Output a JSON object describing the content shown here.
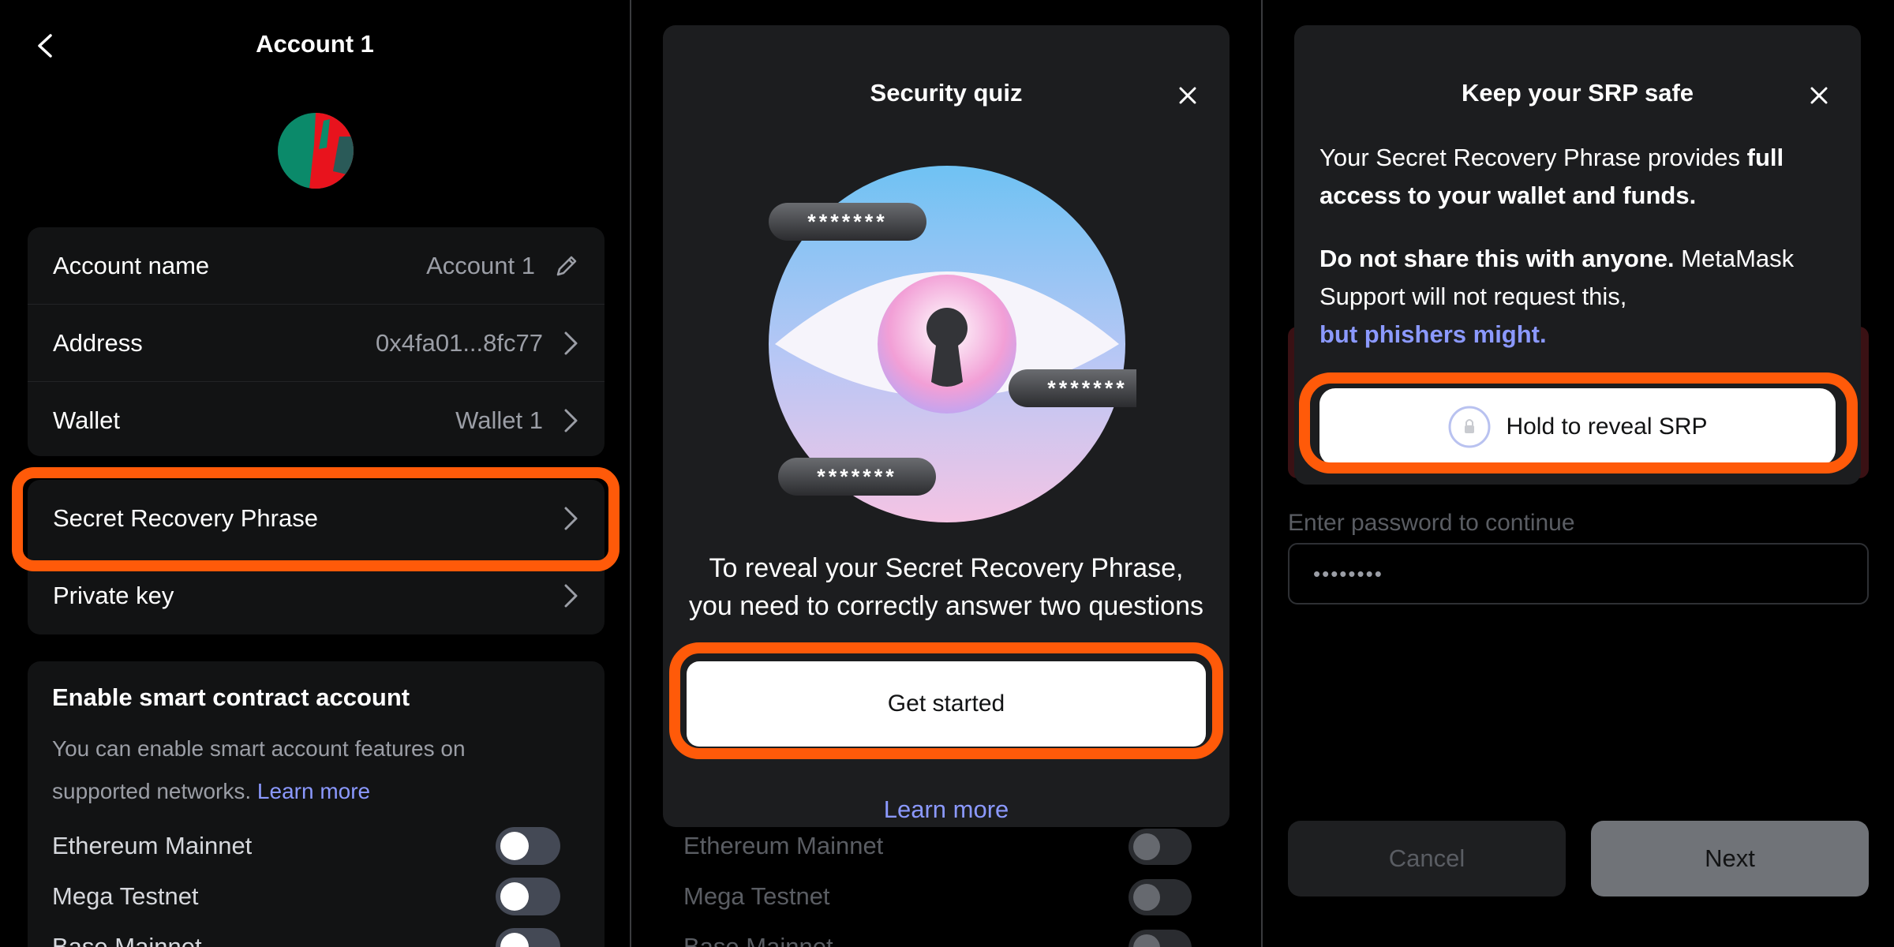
{
  "panel_account": {
    "title": "Account 1",
    "rows": [
      {
        "label": "Account name",
        "value": "Account 1"
      },
      {
        "label": "Address",
        "value": "0x4fa01...8fc77"
      },
      {
        "label": "Wallet",
        "value": "Wallet 1"
      }
    ],
    "srp_label": "Secret Recovery Phrase",
    "private_key_label": "Private key",
    "smart_account": {
      "title": "Enable smart contract account",
      "description": "You can enable smart account features on supported networks.",
      "learn_more": "Learn more"
    },
    "networks": [
      "Ethereum Mainnet",
      "Mega Testnet",
      "Base Mainnet"
    ]
  },
  "panel_quiz": {
    "title": "Security quiz",
    "password_mask": "*******",
    "description": "To reveal your Secret Recovery Phrase, you need to correctly answer two questions",
    "primary_button": "Get started",
    "learn_more": "Learn more",
    "background_networks": [
      "Ethereum Mainnet",
      "Mega Testnet",
      "Base Mainnet"
    ]
  },
  "panel_srp": {
    "modal_title": "Keep your SRP safe",
    "para1_normal": "Your Secret Recovery Phrase provides ",
    "para1_bold": "full access to your wallet and funds.",
    "para2_bold": "Do not share this with anyone.",
    "para2_normal": " MetaMask Support will not request this,",
    "para2_link": "but phishers might.",
    "hold_button": "Hold to reveal SRP",
    "password_label": "Enter password to continue",
    "password_value": "••••••••",
    "cancel_button": "Cancel",
    "next_button": "Next"
  },
  "colors": {
    "accent_link": "#8b99ff",
    "highlight": "#ff5a09",
    "card_bg": "#121314",
    "modal_bg": "#1c1d1f"
  }
}
